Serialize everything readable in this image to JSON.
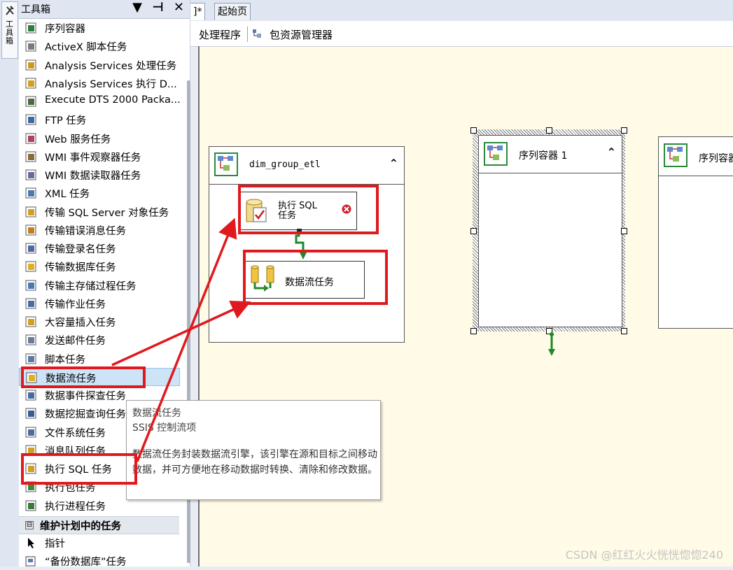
{
  "vertical_tab": {
    "label": "工具箱"
  },
  "toolbox": {
    "title": "工具箱",
    "controls": "▼ ⊣ ✕",
    "items": [
      {
        "label": "序列容器",
        "icon": "sequence-container-icon",
        "color": "#2a7f3a"
      },
      {
        "label": "ActiveX 脚本任务",
        "icon": "activex-script-icon",
        "color": "#7a7a7a"
      },
      {
        "label": "Analysis Services 处理任务",
        "icon": "analysis-process-icon",
        "color": "#d09a20"
      },
      {
        "label": "Analysis Services 执行 D...",
        "icon": "analysis-execute-icon",
        "color": "#d0a020"
      },
      {
        "label": "Execute DTS 2000 Packa...",
        "icon": "dts-package-icon",
        "color": "#4a6a3a"
      },
      {
        "label": "FTP 任务",
        "icon": "ftp-icon",
        "color": "#3a6aa0"
      },
      {
        "label": "Web 服务任务",
        "icon": "web-service-icon",
        "color": "#b04060"
      },
      {
        "label": "WMI 事件观察器任务",
        "icon": "wmi-watcher-icon",
        "color": "#8a6a3a"
      },
      {
        "label": "WMI 数据读取器任务",
        "icon": "wmi-reader-icon",
        "color": "#6a6a9a"
      },
      {
        "label": "XML 任务",
        "icon": "xml-icon",
        "color": "#4a7ab0"
      },
      {
        "label": "传输 SQL Server 对象任务",
        "icon": "transfer-objects-icon",
        "color": "#d0a020"
      },
      {
        "label": "传输错误消息任务",
        "icon": "transfer-errors-icon",
        "color": "#c08020"
      },
      {
        "label": "传输登录名任务",
        "icon": "transfer-logins-icon",
        "color": "#4a6aa0"
      },
      {
        "label": "传输数据库任务",
        "icon": "transfer-database-icon",
        "color": "#e0b020"
      },
      {
        "label": "传输主存储过程任务",
        "icon": "transfer-procs-icon",
        "color": "#4a7ab0"
      },
      {
        "label": "传输作业任务",
        "icon": "transfer-jobs-icon",
        "color": "#4a6aa0"
      },
      {
        "label": "大容量插入任务",
        "icon": "bulk-insert-icon",
        "color": "#d0a020"
      },
      {
        "label": "发送邮件任务",
        "icon": "send-mail-icon",
        "color": "#6a7a9a"
      },
      {
        "label": "脚本任务",
        "icon": "script-icon",
        "color": "#5a7aa0"
      },
      {
        "label": "数据流任务",
        "icon": "data-flow-icon",
        "color": "#e0b020",
        "selected": true
      },
      {
        "label": "数据事件探查任务",
        "icon": "data-profiling-icon",
        "color": "#4a6aa0"
      },
      {
        "label": "数据挖掘查询任务",
        "icon": "data-mining-icon",
        "color": "#3a5a90"
      },
      {
        "label": "文件系统任务",
        "icon": "file-system-icon",
        "color": "#4a6aa0"
      },
      {
        "label": "消息队列任务",
        "icon": "message-queue-icon",
        "color": "#d0a020"
      },
      {
        "label": "执行 SQL 任务",
        "icon": "execute-sql-icon",
        "color": "#d0a020"
      },
      {
        "label": "执行包任务",
        "icon": "execute-package-icon",
        "color": "#3a8a3a"
      },
      {
        "label": "执行进程任务",
        "icon": "execute-process-icon",
        "color": "#3a7a3a"
      }
    ],
    "section": {
      "label": "维护计划中的任务",
      "toggle": "⊟"
    },
    "section_items": [
      {
        "label": "指针",
        "icon": "pointer-icon"
      },
      {
        "label": "“备份数据库”任务",
        "icon": "backup-icon"
      }
    ]
  },
  "doc_tabs": [
    {
      "label": "]*"
    },
    {
      "label": "起始页"
    }
  ],
  "designer_tabs": {
    "event_handler_partial": "处理程序",
    "package_explorer": "包资源管理器"
  },
  "canvas": {
    "container_main": {
      "title": "dim_group_etl",
      "collapse": "⌃"
    },
    "task_sql": {
      "line1": "执行 SQL",
      "line2": "任务"
    },
    "task_dataflow": {
      "label": "数据流任务"
    },
    "container_seq1": {
      "title": "序列容器 1",
      "collapse": "⌃"
    },
    "container_seq2": {
      "title": "序列容器"
    }
  },
  "tooltip": {
    "title": "数据流任务",
    "subtitle": "SSIS 控制流项",
    "description": "数据流任务封装数据流引擎，该引擎在源和目标之间移动数据，并可方便地在移动数据时转换、清除和修改数据。"
  },
  "watermark": "CSDN @红红火火恍恍惚惚240",
  "colors": {
    "annotation_red": "#e0191e",
    "canvas_bg": "#fffbe6",
    "precedence_green": "#1a8a2a"
  }
}
